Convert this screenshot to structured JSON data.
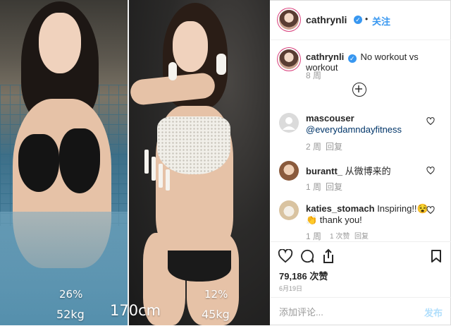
{
  "photo": {
    "left_body_fat": "26%",
    "left_weight": "52kg",
    "height_label": "170cm",
    "right_body_fat": "12%",
    "right_weight": "45kg"
  },
  "header": {
    "username": "cathrynli",
    "follow_label": "关注",
    "separator": "•"
  },
  "caption": {
    "username": "cathrynli",
    "text": "No workout vs workout",
    "time": "8 周"
  },
  "comments": [
    {
      "username": "mascouser",
      "text": "@everydamndayfitness",
      "time": "2 周",
      "reply": "回复",
      "likes": ""
    },
    {
      "username": "burantt_",
      "text": "从微博来的",
      "time": "1 周",
      "reply": "回复",
      "likes": ""
    },
    {
      "username": "katies_stomach",
      "text": "Inspiring!!😵👏 thank you!",
      "time": "1 周",
      "reply": "回复",
      "likes": "1 次赞"
    }
  ],
  "actions": {
    "likes_count": "79,186 次赞",
    "date": "6月19日"
  },
  "comment_box": {
    "placeholder": "添加评论...",
    "post_label": "发布"
  },
  "colors": {
    "accent": "#3897f0",
    "link": "#003569",
    "muted": "#999999",
    "post_disabled": "#b2dffc"
  }
}
